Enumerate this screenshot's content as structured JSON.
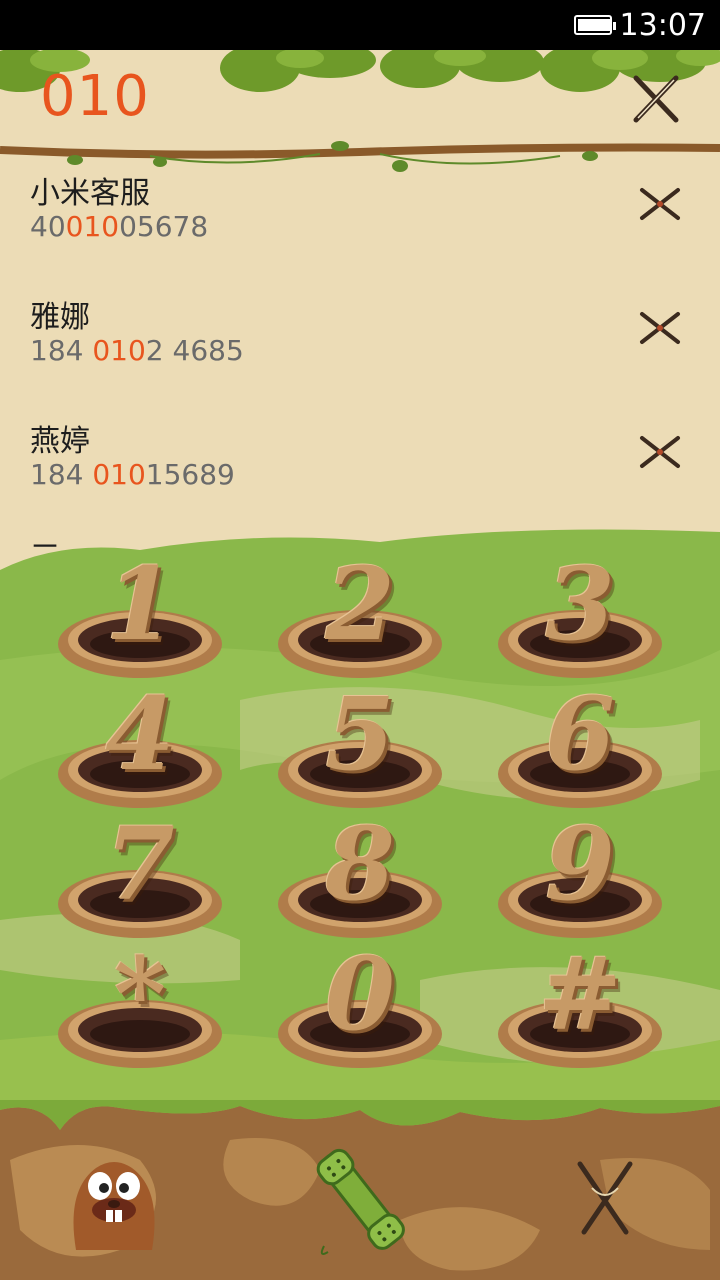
{
  "status_bar": {
    "time": "13:07",
    "battery_level": 0.95
  },
  "dialer": {
    "input": "010"
  },
  "contacts": [
    {
      "name": "小米客服",
      "number_before": "40",
      "number_match": "010",
      "number_after": "05678"
    },
    {
      "name": "雅娜",
      "number_before": "184 ",
      "number_match": "010",
      "number_after": "2 4685"
    },
    {
      "name": "燕婷",
      "number_before": "184 ",
      "number_match": "010",
      "number_after": "15689"
    }
  ],
  "peek_contact": {
    "name": "三"
  },
  "keypad": {
    "keys": [
      "1",
      "2",
      "3",
      "4",
      "5",
      "6",
      "7",
      "8",
      "9",
      "*",
      "0",
      "#"
    ]
  },
  "icons": {
    "clear": "crossed-sticks-icon",
    "call": "crossed-sticks-icon",
    "mascot": "beaver-icon",
    "dial": "green-phone-handset-icon",
    "delete": "slingshot-icon"
  },
  "colors": {
    "accent": "#e8551e",
    "paper": "#ecdcb6",
    "grass": "#8ab84a",
    "dirt": "#9a6a3c"
  }
}
